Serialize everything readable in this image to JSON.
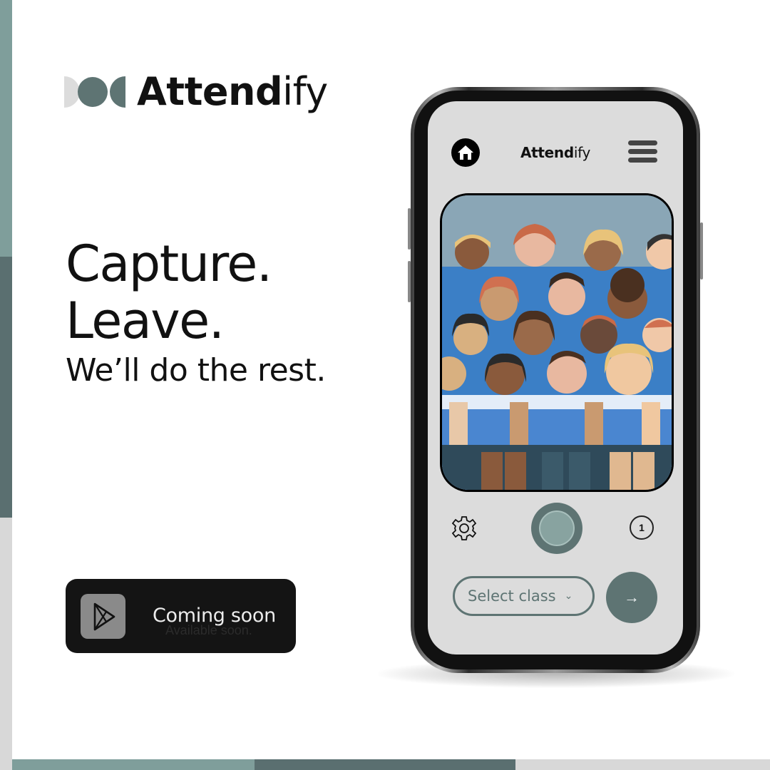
{
  "brand": {
    "name_bold": "Attend",
    "name_light": "ify",
    "logo_colors": [
      "#dcdcdc",
      "#5e7473",
      "#5e7473"
    ]
  },
  "headline": {
    "line1": "Capture.",
    "line2": "Leave.",
    "line3": "We’ll do the rest."
  },
  "store_button": {
    "icon": "play-store-icon",
    "label": "Coming soon",
    "sublabel": "Available soon."
  },
  "phone_app": {
    "home_icon": "home-icon",
    "title_bold": "Attend",
    "title_light": "ify",
    "menu_icon": "hamburger-menu-icon",
    "viewfinder_image": "classroom-students-illustration",
    "settings_icon": "gear-icon",
    "shutter_icon": "shutter-button",
    "photo_count": "1",
    "select_class_label": "Select class",
    "select_chevron": "⌄",
    "next_label": "→"
  },
  "colors": {
    "accent_dark": "#5e7473",
    "accent_light": "#7f9e9b",
    "strip_gray": "#d8d8d8",
    "button_black": "#141414"
  }
}
